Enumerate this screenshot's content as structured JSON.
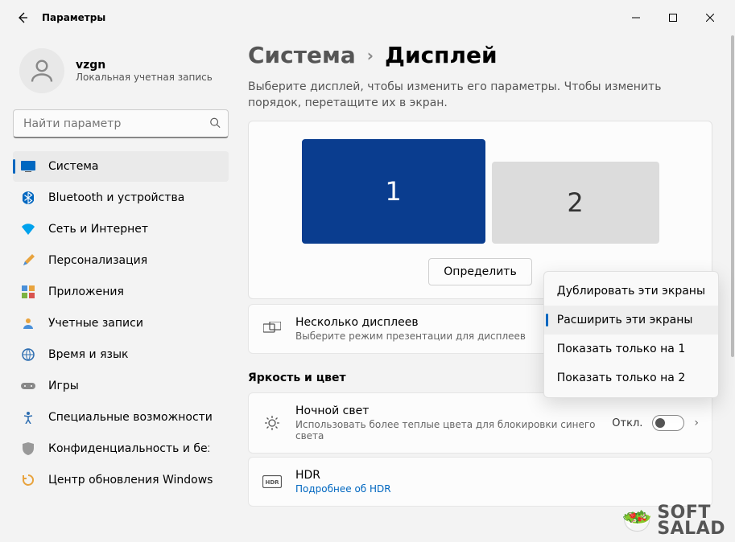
{
  "window": {
    "title": "Параметры"
  },
  "user": {
    "name": "vzgn",
    "subtitle": "Локальная учетная запись"
  },
  "search": {
    "placeholder": "Найти параметр"
  },
  "sidebar": {
    "items": [
      {
        "label": "Система",
        "icon": "💻"
      },
      {
        "label": "Bluetooth и устройства",
        "icon": "bt"
      },
      {
        "label": "Сеть и Интернет",
        "icon": "net"
      },
      {
        "label": "Персонализация",
        "icon": "🖌️"
      },
      {
        "label": "Приложения",
        "icon": "apps"
      },
      {
        "label": "Учетные записи",
        "icon": "👤"
      },
      {
        "label": "Время и язык",
        "icon": "🌐"
      },
      {
        "label": "Игры",
        "icon": "🎮"
      },
      {
        "label": "Специальные возможности",
        "icon": "acc"
      },
      {
        "label": "Конфиденциальность и безопасность",
        "icon": "🛡️"
      },
      {
        "label": "Центр обновления Windows",
        "icon": "🔄"
      }
    ]
  },
  "breadcrumb": {
    "parent": "Система",
    "current": "Дисплей"
  },
  "hint": "Выберите дисплей, чтобы изменить его параметры. Чтобы изменить порядок, перетащите их в экран.",
  "monitors": {
    "m1": "1",
    "m2": "2",
    "identify": "Определить"
  },
  "dropdown": {
    "items": [
      "Дублировать эти экраны",
      "Расширить эти экраны",
      "Показать только на 1",
      "Показать только на 2"
    ]
  },
  "rows": {
    "multi": {
      "title": "Несколько дисплеев",
      "sub": "Выберите режим презентации для дисплеев"
    },
    "night": {
      "title": "Ночной свет",
      "sub": "Использовать более теплые цвета для блокировки синего света",
      "status": "Откл."
    },
    "hdr": {
      "title": "HDR",
      "sub": "Подробнее об HDR"
    }
  },
  "section": {
    "brightness": "Яркость и цвет"
  },
  "watermark": {
    "line1": "SOFT",
    "line2": "SALAD"
  }
}
